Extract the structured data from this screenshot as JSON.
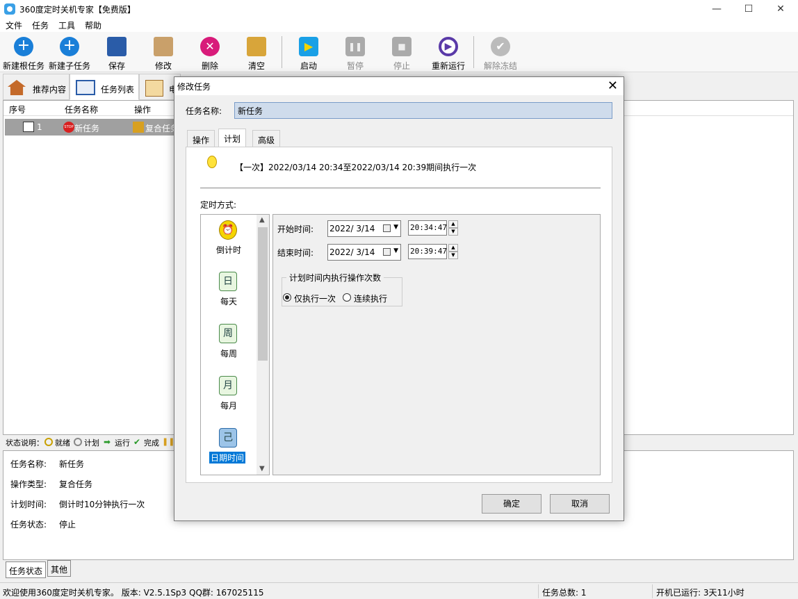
{
  "window": {
    "title": "360度定时关机专家【免费版】",
    "minimize": "—",
    "maximize": "☐",
    "close": "✕"
  },
  "menu": [
    "文件",
    "任务",
    "工具",
    "帮助"
  ],
  "toolbar": [
    {
      "label": "新建根任务",
      "icon": "plus-circle-icon",
      "color": "#1a7fd8"
    },
    {
      "label": "新建子任务",
      "icon": "plus-circle-icon",
      "color": "#1a7fd8"
    },
    {
      "label": "保存",
      "icon": "floppy-icon",
      "color": "#2a5ca8"
    },
    {
      "label": "修改",
      "icon": "edit-icon",
      "color": "#9a6a2a"
    },
    {
      "label": "删除",
      "icon": "delete-icon",
      "color": "#d81b7a"
    },
    {
      "label": "清空",
      "icon": "broom-icon",
      "color": "#3a9a2a"
    },
    {
      "label": "启动",
      "icon": "play-icon",
      "color": "#1aa0e6"
    },
    {
      "label": "暂停",
      "icon": "pause-icon",
      "color": "#999999"
    },
    {
      "label": "停止",
      "icon": "stop-icon",
      "color": "#999999"
    },
    {
      "label": "重新运行",
      "icon": "restart-icon",
      "color": "#5a3aa8"
    },
    {
      "label": "解除冻结",
      "icon": "check-icon",
      "color": "#aaaaaa"
    }
  ],
  "tabs": [
    "推荐内容",
    "任务列表",
    "电"
  ],
  "list": {
    "headers": [
      "序号",
      "任务名称",
      "操作"
    ],
    "rows": [
      {
        "index": "1",
        "name": "新任务",
        "action": "复合任务"
      }
    ]
  },
  "legend": {
    "title": "状态说明：",
    "items": [
      "就绪",
      "计划",
      "运行",
      "完成"
    ]
  },
  "details": {
    "name_label": "任务名称:",
    "name": "新任务",
    "type_label": "操作类型:",
    "type": "复合任务",
    "plan_label": "计划时间:",
    "plan": "倒计时10分钟执行一次",
    "status_label": "任务状态:",
    "status": "停止"
  },
  "bottom_tabs": [
    "任务状态",
    "其他"
  ],
  "statusbar": {
    "welcome": "欢迎使用360度定时关机专家。 版本: V2.5.1Sp3  QQ群: 167025115",
    "total": "任务总数: 1",
    "uptime": "开机已运行: 3天11小时"
  },
  "dialog": {
    "title": "修改任务",
    "close": "✕",
    "name_label": "任务名称:",
    "name_value": "新任务",
    "tabs": [
      "操作",
      "计划",
      "高级"
    ],
    "summary": "【一次】2022/03/14 20:34至2022/03/14 20:39期间执行一次",
    "mode_label": "定时方式:",
    "modes": [
      {
        "label": "倒计时",
        "icon": "alarm-clock-icon",
        "glyph": "⏰"
      },
      {
        "label": "每天",
        "icon": "calendar-day-icon",
        "glyph": "日"
      },
      {
        "label": "每周",
        "icon": "calendar-week-icon",
        "glyph": "周"
      },
      {
        "label": "每月",
        "icon": "calendar-month-icon",
        "glyph": "月"
      },
      {
        "label": "日期时间",
        "icon": "calendar-datetime-icon",
        "glyph": "己"
      }
    ],
    "selected_mode": "日期时间",
    "start_label": "开始时间:",
    "start_date": "2022/  3/14",
    "start_time": "20:34:47",
    "end_label": "结束时间:",
    "end_date": "2022/  3/14",
    "end_time": "20:39:47",
    "group_label": "计划时间内执行操作次数",
    "radio_once": "仅执行一次",
    "radio_continuous": "连续执行",
    "radio_selected": "仅执行一次",
    "ok": "确定",
    "cancel": "取消"
  }
}
